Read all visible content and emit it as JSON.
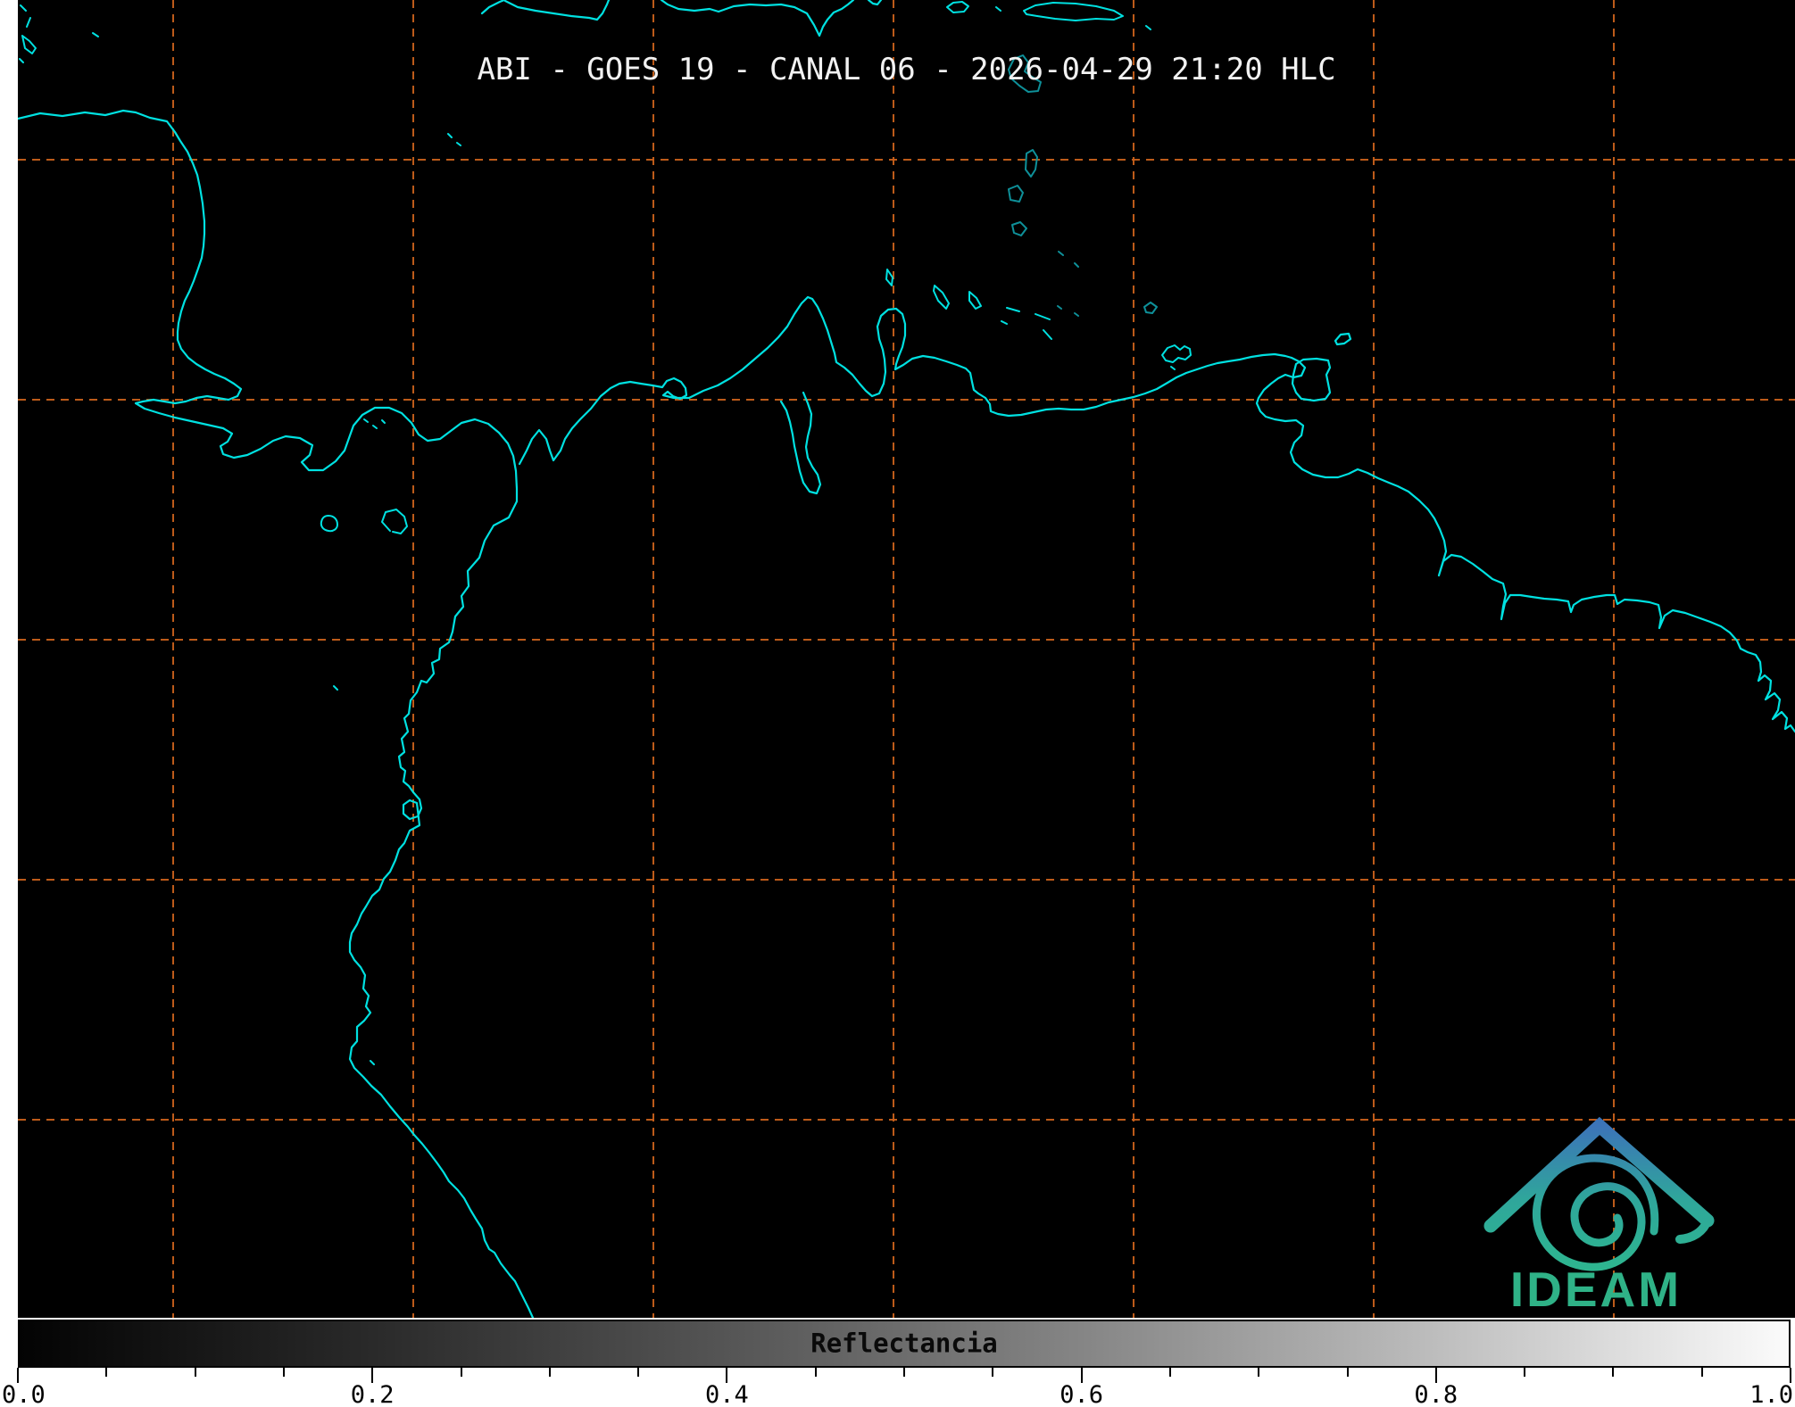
{
  "header": {
    "title": "ABI - GOES 19 - CANAL 06 - 2026-04-29 21:20 HLC"
  },
  "map": {
    "background_color": "#000000",
    "coastline_color": "#00E1E1",
    "coastline_dim_color": "#0E9099",
    "graticule": {
      "color": "#C8601C",
      "x_lines": [
        194,
        463,
        732,
        1001,
        1270,
        1539,
        1808
      ],
      "y_lines": [
        179,
        448,
        717,
        986,
        1255
      ]
    }
  },
  "colorbar": {
    "label": "Reflectancia",
    "min": 0.0,
    "max": 1.0,
    "gradient": [
      "#000000",
      "#ffffff"
    ],
    "major_ticks": [
      {
        "label": "0.0",
        "frac": 0.0,
        "align": "left"
      },
      {
        "label": "0.2",
        "frac": 0.2,
        "align": "center"
      },
      {
        "label": "0.4",
        "frac": 0.4,
        "align": "center"
      },
      {
        "label": "0.6",
        "frac": 0.6,
        "align": "center"
      },
      {
        "label": "0.8",
        "frac": 0.8,
        "align": "center"
      },
      {
        "label": "1.0",
        "frac": 1.0,
        "align": "right"
      }
    ],
    "minor_tick_step": 0.05
  },
  "logo": {
    "text": "IDEAM",
    "gradient_top": "#3C74B8",
    "gradient_mid": "#2FA69B",
    "gradient_bottom": "#2DBA8C",
    "text_color": "#2FB287"
  }
}
